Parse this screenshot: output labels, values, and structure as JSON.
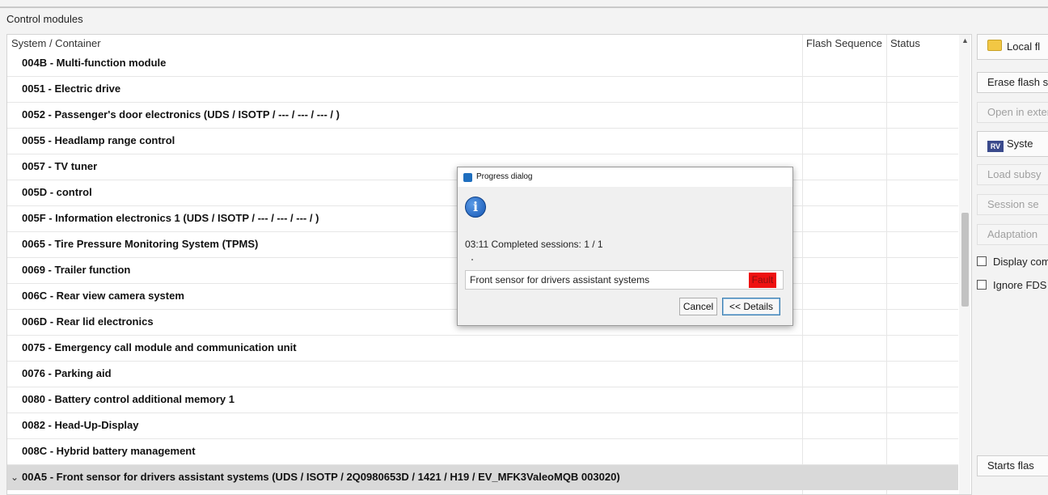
{
  "panel": {
    "title": "Control modules"
  },
  "columns": {
    "system": "System / Container",
    "flash": "Flash Sequence",
    "status": "Status"
  },
  "rows": [
    "004B - Multi-function module",
    "0051 - Electric drive",
    "0052 - Passenger's door electronics  (UDS / ISOTP / --- / --- / --- /  )",
    "0055 - Headlamp range control",
    "0057 - TV tuner",
    "005D - control",
    "005F - Information electronics 1  (UDS / ISOTP / --- / --- / --- /  )",
    "0065 - Tire Pressure Monitoring System (TPMS)",
    "0069 - Trailer function",
    "006C - Rear view camera system",
    "006D - Rear lid electronics",
    "0075 - Emergency call module and communication unit",
    "0076 - Parking aid",
    "0080 - Battery control additional memory 1",
    "0082 - Head-Up-Display",
    "008C - Hybrid battery management"
  ],
  "selected_row": "00A5 - Front sensor for drivers assistant systems  (UDS / ISOTP / 2Q0980653D / 1421 / H19 / EV_MFK3ValeoMQB 003020)",
  "right_panel": {
    "local_flash": "Local fl",
    "erase_flash": "Erase flash s",
    "open_external": "Open in exter",
    "system": "Syste",
    "load_subsystems": "Load subsy",
    "session": "Session se",
    "adaptation": "Adaptation",
    "display_com": "Display com",
    "ignore_fds": "Ignore FDS",
    "starts_flash": "Starts flas"
  },
  "dialog": {
    "title": "Progress dialog",
    "status": "03:11  Completed sessions: 1 / 1",
    "item": "Front sensor for drivers assistant systems",
    "item_status": "Fault",
    "cancel": "Cancel",
    "details": "<< Details"
  },
  "colors": {
    "fault": "#ee1111",
    "selected": "#d9d9d9",
    "info": "#1557b4"
  }
}
